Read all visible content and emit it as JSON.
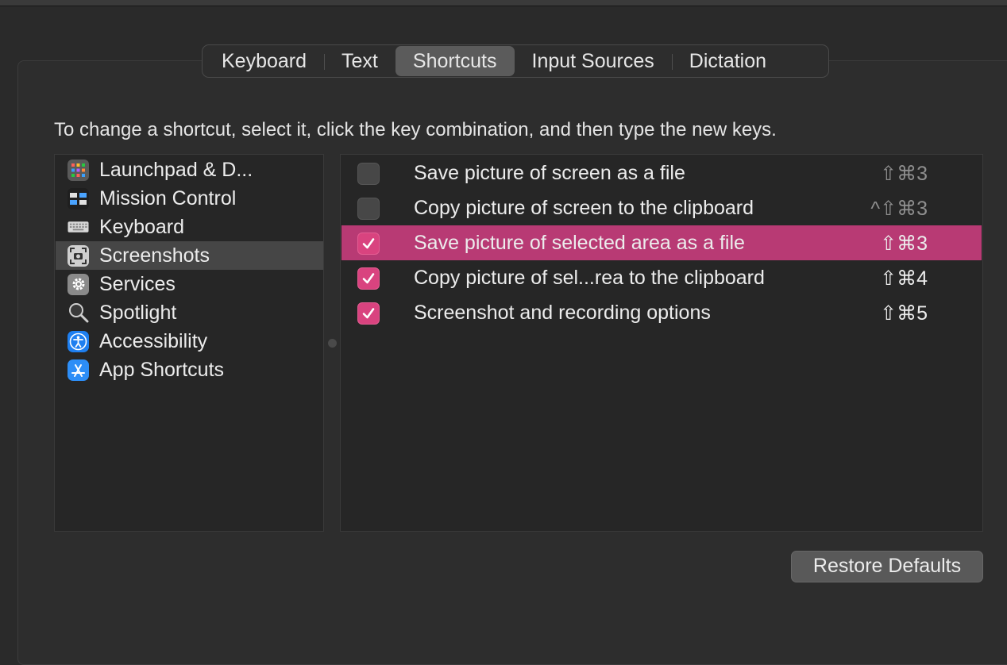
{
  "tabs": [
    {
      "label": "Keyboard",
      "active": false
    },
    {
      "label": "Text",
      "active": false
    },
    {
      "label": "Shortcuts",
      "active": true
    },
    {
      "label": "Input Sources",
      "active": false
    },
    {
      "label": "Dictation",
      "active": false
    }
  ],
  "instruction": "To change a shortcut, select it, click the key combination, and then type the new keys.",
  "sidebar": {
    "items": [
      {
        "label": "Launchpad & D...",
        "icon": "launchpad-icon",
        "selected": false
      },
      {
        "label": "Mission Control",
        "icon": "mission-control-icon",
        "selected": false
      },
      {
        "label": "Keyboard",
        "icon": "keyboard-icon",
        "selected": false
      },
      {
        "label": "Screenshots",
        "icon": "screenshots-icon",
        "selected": true
      },
      {
        "label": "Services",
        "icon": "gear-icon",
        "selected": false
      },
      {
        "label": "Spotlight",
        "icon": "magnifier-icon",
        "selected": false
      },
      {
        "label": "Accessibility",
        "icon": "accessibility-icon",
        "selected": false
      },
      {
        "label": "App Shortcuts",
        "icon": "app-store-icon",
        "selected": false
      }
    ]
  },
  "shortcuts": [
    {
      "label": "Save picture of screen as a file",
      "keys": "⇧⌘3",
      "checked": false,
      "selected": false,
      "keys_dimmed": true
    },
    {
      "label": "Copy picture of screen to the clipboard",
      "keys": "^⇧⌘3",
      "checked": false,
      "selected": false,
      "keys_dimmed": true
    },
    {
      "label": "Save picture of selected area as a file",
      "keys": "⇧⌘3",
      "checked": true,
      "selected": true,
      "keys_dimmed": false
    },
    {
      "label": "Copy picture of sel...rea to the clipboard",
      "keys": "⇧⌘4",
      "checked": true,
      "selected": false,
      "keys_dimmed": false
    },
    {
      "label": "Screenshot and recording options",
      "keys": "⇧⌘5",
      "checked": true,
      "selected": false,
      "keys_dimmed": false
    }
  ],
  "restore_button": "Restore Defaults",
  "colors": {
    "selection": "#b83a74",
    "checkbox_checked": "#d9437f",
    "background": "#2a2a2a"
  }
}
